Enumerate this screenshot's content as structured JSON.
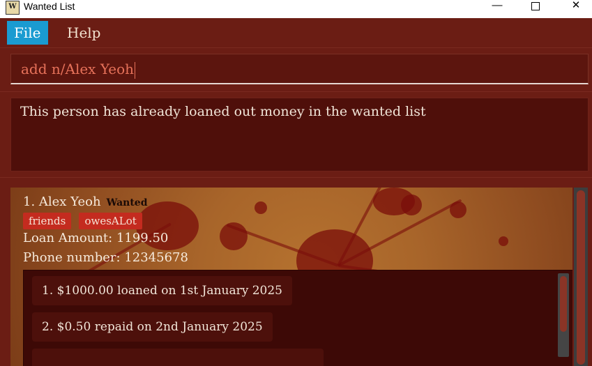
{
  "window": {
    "title": "Wanted List",
    "app_icon_glyph": "W",
    "minimize_glyph": "—",
    "close_glyph": "✕"
  },
  "menu": {
    "items": [
      {
        "label": "File",
        "active": true
      },
      {
        "label": "Help",
        "active": false
      }
    ]
  },
  "command": {
    "value": "add n/Alex Yeoh"
  },
  "result": {
    "message": "This person has already loaned out money in the wanted list"
  },
  "persons": [
    {
      "index_name": "1. Alex Yeoh",
      "status": "Wanted",
      "tags": [
        "friends",
        "owesALot"
      ],
      "loan_amount": "Loan Amount: 1199.50",
      "phone": "Phone number: 12345678",
      "transactions": [
        "1. $1000.00 loaned on 1st January 2025",
        "2. $0.50 repaid on 2nd January 2025"
      ]
    }
  ],
  "colors": {
    "accent_menu": "#1a9bd1",
    "background": "#5a1810",
    "tag": "#c42b1f",
    "command_text": "#e7725a"
  }
}
